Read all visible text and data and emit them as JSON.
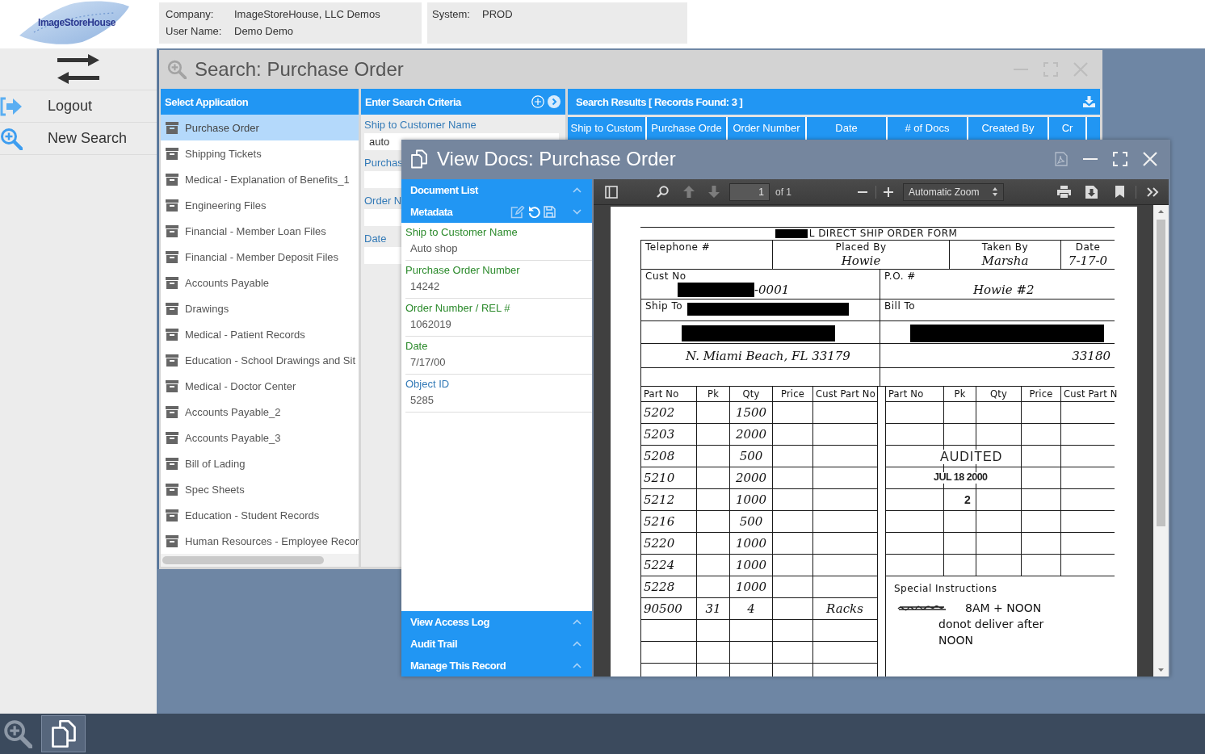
{
  "header": {
    "logo": "ImageStoreHouse",
    "user_info": [
      {
        "label": "Company:",
        "value": "ImageStoreHouse, LLC Demos"
      },
      {
        "label": "User Name:",
        "value": "Demo Demo"
      }
    ],
    "system_info": [
      {
        "label": "System:",
        "value": "PROD"
      }
    ]
  },
  "sidebar": {
    "items": [
      {
        "kind": "logout",
        "label": "Logout"
      },
      {
        "kind": "new_search",
        "label": "New Search"
      }
    ]
  },
  "search_window": {
    "title": "Search: Purchase Order",
    "applications": {
      "title": "Select Application",
      "items": [
        {
          "label": "Purchase Order",
          "selected": true
        },
        {
          "label": "Shipping Tickets",
          "selected": false
        },
        {
          "label": "Medical - Explanation of Benefits_1",
          "selected": false
        },
        {
          "label": "Engineering Files",
          "selected": false
        },
        {
          "label": "Financial - Member Loan Files",
          "selected": false
        },
        {
          "label": "Financial - Member Deposit Files",
          "selected": false
        },
        {
          "label": "Accounts Payable",
          "selected": false
        },
        {
          "label": "Drawings",
          "selected": false
        },
        {
          "label": "Medical - Patient Records",
          "selected": false
        },
        {
          "label": "Education - School Drawings and Sit",
          "selected": false
        },
        {
          "label": "Medical - Doctor Center",
          "selected": false
        },
        {
          "label": "Accounts Payable_2",
          "selected": false
        },
        {
          "label": "Accounts Payable_3",
          "selected": false
        },
        {
          "label": "Bill of Lading",
          "selected": false
        },
        {
          "label": "Spec Sheets",
          "selected": false
        },
        {
          "label": "Education - Student Records",
          "selected": false
        },
        {
          "label": "Human Resources - Employee Recor",
          "selected": false
        }
      ]
    },
    "criteria": {
      "title": "Enter Search Criteria",
      "fields": [
        {
          "label": "Ship to Customer Name",
          "value": "auto"
        },
        {
          "label": "Purchas"
        },
        {
          "label": "Order N"
        },
        {
          "label": "Date"
        }
      ]
    },
    "results": {
      "title": "Search Results [ Records Found: 3 ]",
      "columns": [
        "Ship to Custom",
        "Purchase Orde",
        "Order Number",
        "Date",
        "# of Docs",
        "Created By",
        "Cr"
      ]
    }
  },
  "viewer_window": {
    "title": "View Docs: Purchase Order",
    "panels": [
      {
        "label": "Document List",
        "expanded": false,
        "tools": false
      },
      {
        "label": "Metadata",
        "expanded": true,
        "tools": true
      },
      {
        "label": "View Access Log",
        "expanded": false,
        "tools": false
      },
      {
        "label": "Audit Trail",
        "expanded": false,
        "tools": false
      },
      {
        "label": "Manage This Record",
        "expanded": false,
        "tools": false
      }
    ],
    "metadata": [
      {
        "label": "Ship to Customer Name",
        "value": "Auto shop",
        "read_only": false
      },
      {
        "label": "Purchase Order Number",
        "value": "14242",
        "read_only": false
      },
      {
        "label": "Order Number / REL #",
        "value": "1062019",
        "read_only": false
      },
      {
        "label": "Date",
        "value": "7/17/00",
        "read_only": false
      },
      {
        "label": "Object ID",
        "value": "5285",
        "read_only": true
      }
    ],
    "pdf_toolbar": {
      "page": "1",
      "page_count": "of 1",
      "zoom": "Automatic Zoom"
    },
    "document": {
      "title": "L DIRECT SHIP ORDER FORM",
      "top_fields": [
        {
          "label": "Telephone #"
        },
        {
          "label": "Placed By",
          "value": "Howie"
        },
        {
          "label": "Taken By",
          "value": "Marsha"
        },
        {
          "label": "Date",
          "value": "7-17-0"
        }
      ],
      "customer": {
        "label": "Cust No",
        "value": "-0001"
      },
      "po": {
        "label": "P.O. #",
        "value": "Howie #2"
      },
      "ship_to": {
        "label": "Ship To",
        "address": "N. Miami Beach, FL 33179"
      },
      "bill_to": {
        "label": "Bill To",
        "address": "33180"
      },
      "left_columns": [
        "Part No",
        "Pk",
        "Qty",
        "Price",
        "Cust Part No"
      ],
      "right_columns": [
        "Part No",
        "Pk",
        "Qty",
        "Price",
        "Cust Part N"
      ],
      "parts": [
        {
          "part_no": "5202",
          "qty": "1500"
        },
        {
          "part_no": "5203",
          "qty": "2000"
        },
        {
          "part_no": "5208",
          "qty": "500"
        },
        {
          "part_no": "5210",
          "qty": "2000"
        },
        {
          "part_no": "5212",
          "qty": "1000"
        },
        {
          "part_no": "5216",
          "qty": "500"
        },
        {
          "part_no": "5220",
          "qty": "1000"
        },
        {
          "part_no": "5224",
          "qty": "1000"
        },
        {
          "part_no": "5228",
          "qty": "1000"
        },
        {
          "part_no": "90500",
          "pk": "31",
          "qty": "4",
          "cust_part_no": "Racks"
        }
      ],
      "stamp": [
        "AUDITED",
        "JUL 18 2000",
        "2"
      ],
      "special_instructions": {
        "label": "Special Instructions",
        "lines": [
          "8AM + NOON",
          "donot deliver after",
          "NOON"
        ]
      }
    }
  }
}
